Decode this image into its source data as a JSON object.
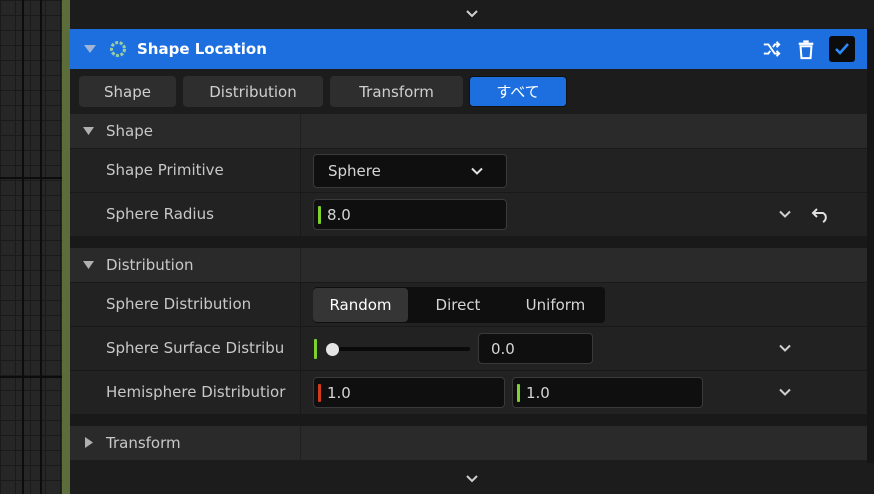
{
  "header": {
    "title": "Shape Location",
    "accent_color": "#1d6fe0",
    "icons": [
      "collapse-triangle-icon",
      "gear-icon",
      "shuffle-icon",
      "trash-icon",
      "checkbox-checked-icon"
    ]
  },
  "tabs": [
    {
      "label": "Shape",
      "active": false
    },
    {
      "label": "Distribution",
      "active": false
    },
    {
      "label": "Transform",
      "active": false
    },
    {
      "label": "すべて",
      "active": true
    }
  ],
  "sections": {
    "shape": {
      "label": "Shape",
      "primitive": {
        "label": "Shape Primitive",
        "value": "Sphere"
      },
      "radius": {
        "label": "Sphere Radius",
        "value": "8.0"
      }
    },
    "distribution": {
      "label": "Distribution",
      "sphere_distribution": {
        "label": "Sphere Distribution",
        "options": [
          "Random",
          "Direct",
          "Uniform"
        ],
        "selected": "Random"
      },
      "surface": {
        "label": "Sphere Surface Distribu",
        "value": "0.0",
        "slider_fraction": 0.0
      },
      "hemisphere": {
        "label": "Hemisphere Distributior",
        "x": "1.0",
        "y": "1.0"
      }
    },
    "transform": {
      "label": "Transform"
    }
  },
  "colors": {
    "marker_green": "#7fd22e",
    "marker_red": "#d23a1e"
  }
}
